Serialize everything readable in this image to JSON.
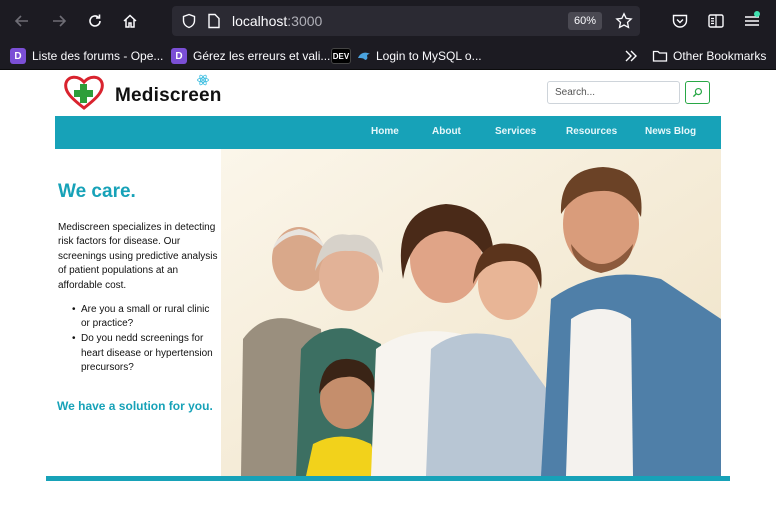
{
  "browser": {
    "url_host": "localhost",
    "url_port": ":3000",
    "zoom": "60%",
    "bookmarks": [
      {
        "label": "Liste des forums - Ope...",
        "icon": "discourse-icon"
      },
      {
        "label": "Gérez les erreurs et vali...",
        "icon": "discourse-icon"
      },
      {
        "label": "Login to MySQL o...",
        "icon": "dev-icon"
      },
      {
        "label": "Other Bookmarks",
        "icon": "folder-icon"
      }
    ],
    "dev_badge": "DEV"
  },
  "site": {
    "logo_text": "Mediscreen",
    "search_placeholder": "Search...",
    "nav": [
      "Home",
      "About",
      "Services",
      "Resources",
      "News Blog"
    ]
  },
  "hero": {
    "title": "We care.",
    "description": "Mediscreen specializes in detecting risk factors for disease. Our screenings using predictive analysis of patient populations at an affordable cost.",
    "bullets": [
      "Are you a small or rural clinic or practice?",
      "Do you nedd screenings for heart disease or hypertension precursors?"
    ],
    "solution": "We have a solution for you."
  },
  "colors": {
    "accent": "#17a2b8",
    "toolbar": "#1c1b22",
    "search_button": "#28a745"
  }
}
